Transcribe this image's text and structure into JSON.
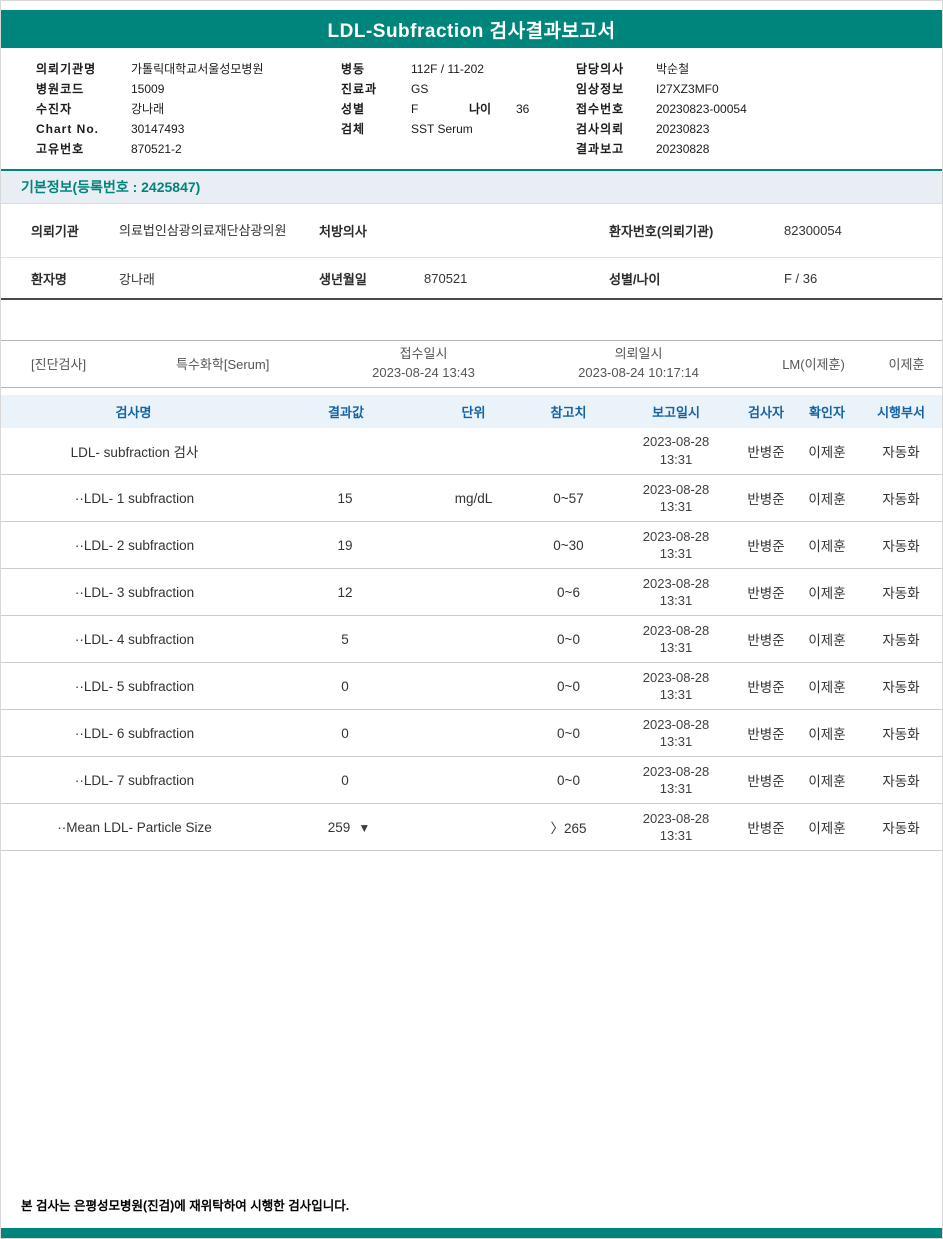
{
  "title": "LDL-Subfraction 검사결과보고서",
  "colors": {
    "teal": "#00857C",
    "header_blue": "#1464a5",
    "banner_bg": "#e9eef4"
  },
  "header": {
    "col1": [
      {
        "label": "의뢰기관명",
        "value": "가톨릭대학교서울성모병원"
      },
      {
        "label": "병원코드",
        "value": "15009"
      },
      {
        "label": "수진자",
        "value": "강나래"
      },
      {
        "label": "Chart No.",
        "value": "30147493"
      },
      {
        "label": "고유번호",
        "value": "870521-2"
      }
    ],
    "col2": [
      {
        "label": "병동",
        "value": "112F / 11-202"
      },
      {
        "label": "진료과",
        "value": "GS"
      },
      {
        "label": "성별",
        "value": "F"
      },
      {
        "label": "검체",
        "value": "SST Serum"
      }
    ],
    "age_label": "나이",
    "age_value": "36",
    "col3": [
      {
        "label": "담당의사",
        "value": "박순철"
      },
      {
        "label": "임상정보",
        "value": "I27XZ3MF0"
      },
      {
        "label": "접수번호",
        "value": "20230823-00054"
      },
      {
        "label": "검사의뢰",
        "value": "20230823"
      },
      {
        "label": "결과보고",
        "value": "20230828"
      }
    ]
  },
  "basic_info": {
    "banner": "기본정보(등록번호 : 2425847)",
    "row1": {
      "label1": "의뢰기관",
      "value1": "의료법인삼광의료재단삼광의원",
      "label2": "처방의사",
      "value2": "",
      "label3": "환자번호(의뢰기관)",
      "value3": "82300054"
    },
    "row2": {
      "label1": "환자명",
      "value1": "강나래",
      "label2": "생년월일",
      "value2": "870521",
      "label3": "성별/나이",
      "value3": "F / 36"
    }
  },
  "section": {
    "dept": "[진단검사]",
    "category": "특수화학[Serum]",
    "receipt_label": "접수일시",
    "receipt_value": "2023-08-24 13:43",
    "request_label": "의뢰일시",
    "request_value": "2023-08-24 10:17:14",
    "lm": "LM(이제훈)",
    "confirmer": "이제훈"
  },
  "results": {
    "headers": [
      "검사명",
      "결과값",
      "단위",
      "참고치",
      "보고일시",
      "검사자",
      "확인자",
      "시행부서"
    ],
    "rows": [
      {
        "name": "LDL- subfraction 검사",
        "result": "",
        "flag": "",
        "unit": "",
        "ref": "",
        "date": "2023-08-28",
        "time": "13:31",
        "tester": "반병준",
        "confirmer": "이제훈",
        "dept": "자동화"
      },
      {
        "name": "··LDL- 1 subfraction",
        "result": "15",
        "flag": "",
        "unit": "mg/dL",
        "ref": "0~57",
        "date": "2023-08-28",
        "time": "13:31",
        "tester": "반병준",
        "confirmer": "이제훈",
        "dept": "자동화"
      },
      {
        "name": "··LDL- 2 subfraction",
        "result": "19",
        "flag": "",
        "unit": "",
        "ref": "0~30",
        "date": "2023-08-28",
        "time": "13:31",
        "tester": "반병준",
        "confirmer": "이제훈",
        "dept": "자동화"
      },
      {
        "name": "··LDL- 3 subfraction",
        "result": "12",
        "flag": "",
        "unit": "",
        "ref": "0~6",
        "date": "2023-08-28",
        "time": "13:31",
        "tester": "반병준",
        "confirmer": "이제훈",
        "dept": "자동화"
      },
      {
        "name": "··LDL- 4 subfraction",
        "result": "5",
        "flag": "",
        "unit": "",
        "ref": "0~0",
        "date": "2023-08-28",
        "time": "13:31",
        "tester": "반병준",
        "confirmer": "이제훈",
        "dept": "자동화"
      },
      {
        "name": "··LDL- 5 subfraction",
        "result": "0",
        "flag": "",
        "unit": "",
        "ref": "0~0",
        "date": "2023-08-28",
        "time": "13:31",
        "tester": "반병준",
        "confirmer": "이제훈",
        "dept": "자동화"
      },
      {
        "name": "··LDL- 6 subfraction",
        "result": "0",
        "flag": "",
        "unit": "",
        "ref": "0~0",
        "date": "2023-08-28",
        "time": "13:31",
        "tester": "반병준",
        "confirmer": "이제훈",
        "dept": "자동화"
      },
      {
        "name": "··LDL- 7 subfraction",
        "result": "0",
        "flag": "",
        "unit": "",
        "ref": "0~0",
        "date": "2023-08-28",
        "time": "13:31",
        "tester": "반병준",
        "confirmer": "이제훈",
        "dept": "자동화"
      },
      {
        "name": "··Mean LDL- Particle Size",
        "result": "259",
        "flag": "▼",
        "unit": "",
        "ref": "〉265",
        "date": "2023-08-28",
        "time": "13:31",
        "tester": "반병준",
        "confirmer": "이제훈",
        "dept": "자동화"
      }
    ]
  },
  "footer": {
    "note": "본 검사는 은평성모병원(진검)에 재위탁하여 시행한 검사입니다."
  }
}
